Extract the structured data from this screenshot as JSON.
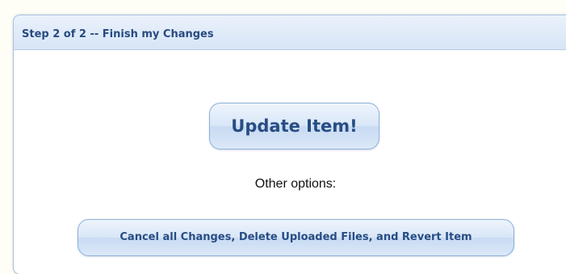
{
  "panel": {
    "title": "Step 2 of 2 -- Finish my Changes"
  },
  "actions": {
    "update_label": "Update Item!",
    "other_options_label": "Other options:",
    "cancel_label": "Cancel all Changes, Delete Uploaded Files, and Revert Item"
  },
  "colors": {
    "page_background": "#fffef6",
    "header_gradient_top": "#eaf2fb",
    "header_gradient_bottom": "#d7e5f6",
    "accent_text": "#274a80",
    "button_border": "#8fb0d8"
  }
}
